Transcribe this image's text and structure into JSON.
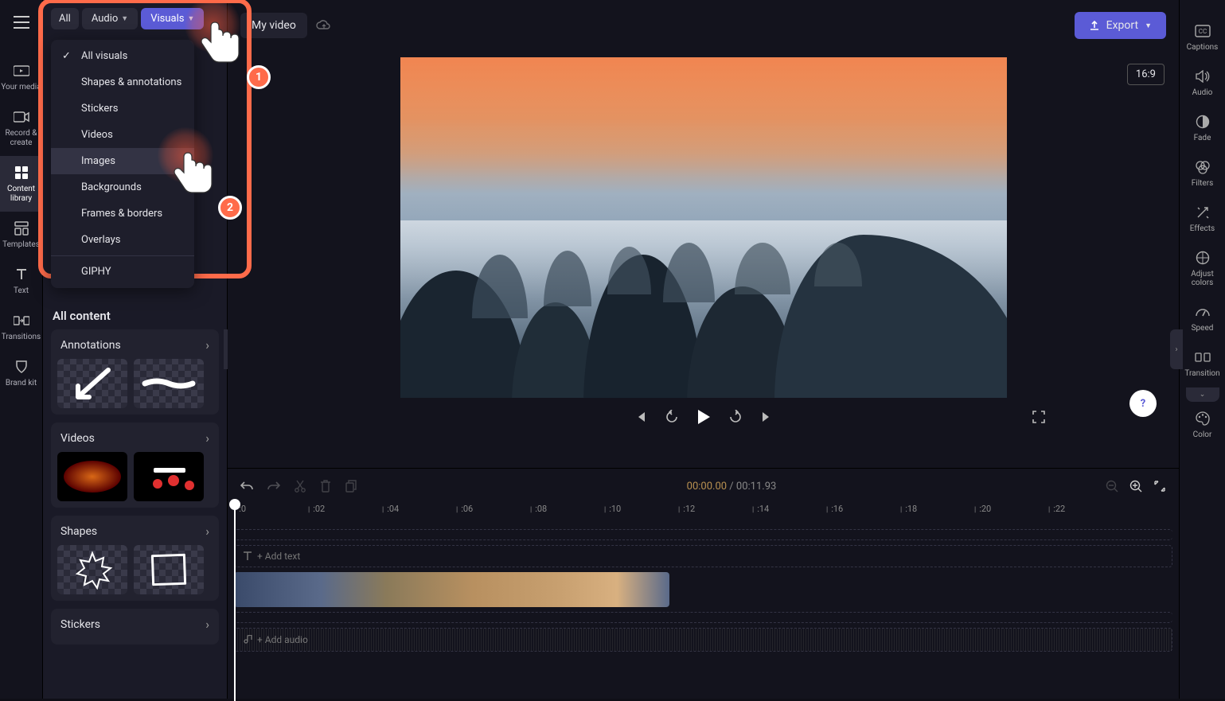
{
  "left_rail": {
    "items": [
      {
        "label": "Your media"
      },
      {
        "label": "Record & create"
      },
      {
        "label": "Content library"
      },
      {
        "label": "Templates"
      },
      {
        "label": "Text"
      },
      {
        "label": "Transitions"
      },
      {
        "label": "Brand kit"
      }
    ]
  },
  "content_tabs": {
    "all": "All",
    "audio": "Audio",
    "visuals": "Visuals"
  },
  "dropdown": {
    "items": [
      "All visuals",
      "Shapes & annotations",
      "Stickers",
      "Videos",
      "Images",
      "Backgrounds",
      "Frames & borders",
      "Overlays"
    ],
    "giphy": "GIPHY"
  },
  "tutorial": {
    "badge1": "1",
    "badge2": "2"
  },
  "sections": {
    "all_content": "All content",
    "annotations": "Annotations",
    "videos": "Videos",
    "shapes": "Shapes",
    "stickers": "Stickers"
  },
  "topbar": {
    "project_name": "My video",
    "export": "Export",
    "aspect": "16:9"
  },
  "playback": {
    "current": "00:00.00",
    "separator": " / ",
    "total": "00:11.93"
  },
  "timeline": {
    "ticks": [
      ":0",
      ":02",
      ":04",
      ":06",
      ":08",
      ":10",
      ":12",
      ":14",
      ":16",
      ":18",
      ":20",
      ":22"
    ],
    "add_text": "+ Add text",
    "add_audio": "+ Add audio"
  },
  "right_rail": {
    "items": [
      "Captions",
      "Audio",
      "Fade",
      "Filters",
      "Effects",
      "Adjust colors",
      "Speed",
      "Transition",
      "Color"
    ]
  },
  "help": "?"
}
